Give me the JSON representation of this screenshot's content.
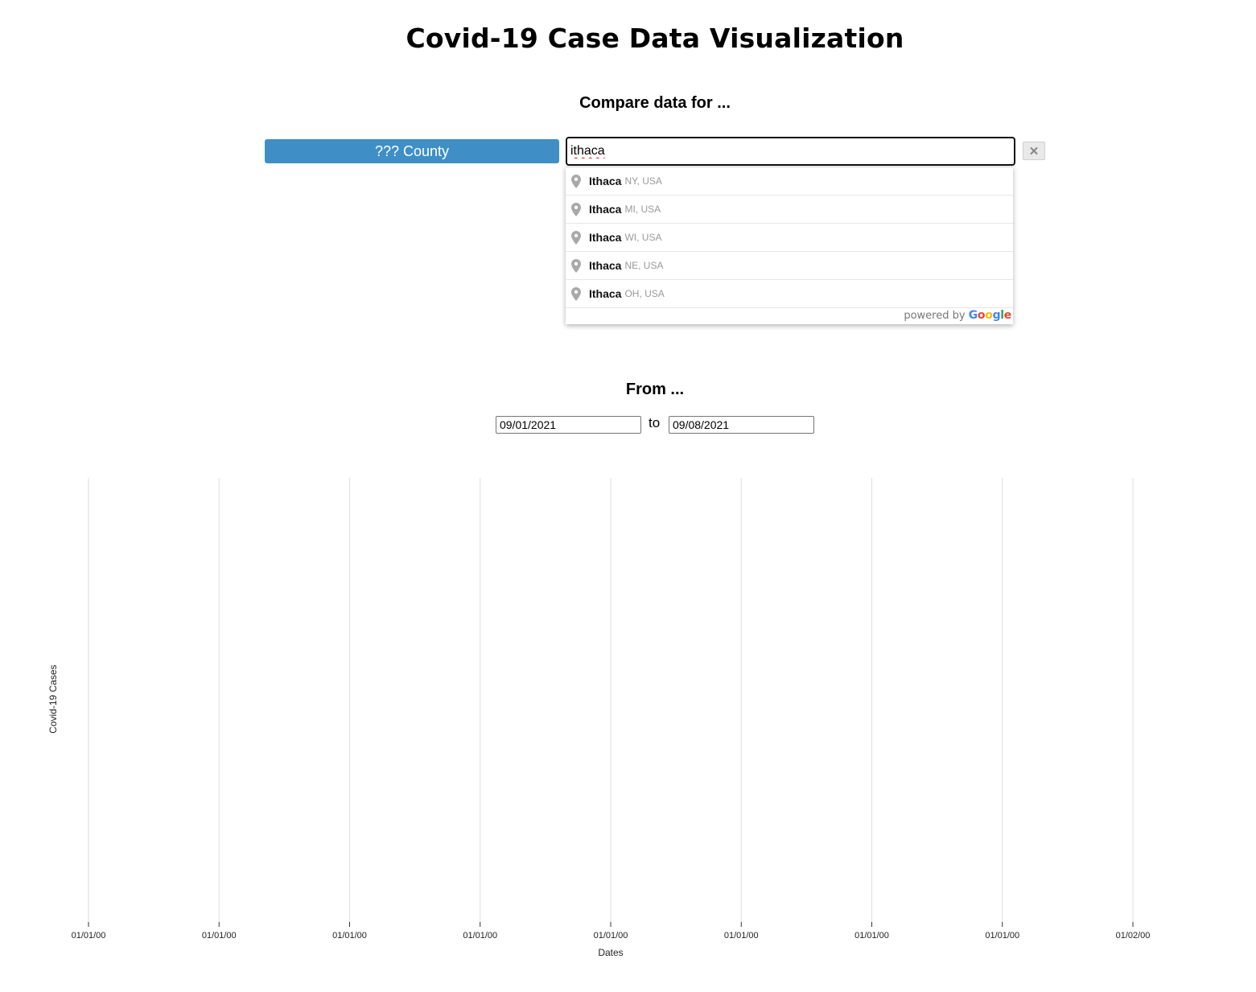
{
  "page": {
    "title": "Covid-19 Case Data Visualization",
    "compare_heading": "Compare data for ...",
    "from_heading": "From ...",
    "to_label": "to"
  },
  "location": {
    "county_label": "??? County",
    "search_value": "ithaca",
    "remove_label": "✕"
  },
  "suggestions": [
    {
      "main": "Ithaca",
      "secondary": "NY, USA"
    },
    {
      "main": "Ithaca",
      "secondary": "MI, USA"
    },
    {
      "main": "Ithaca",
      "secondary": "WI, USA"
    },
    {
      "main": "Ithaca",
      "secondary": "NE, USA"
    },
    {
      "main": "Ithaca",
      "secondary": "OH, USA"
    }
  ],
  "attribution": {
    "prefix": "powered by",
    "brand": "Google"
  },
  "date_range": {
    "start": "09/01/2021",
    "end": "09/08/2021"
  },
  "colors": {
    "chip": "#3f8fc6",
    "gridline": "#dddddd",
    "google_blue": "#4285F4",
    "google_red": "#EA4335",
    "google_yellow": "#FBBC05",
    "google_green": "#34A853"
  },
  "chart_data": {
    "type": "line",
    "xlabel": "Dates",
    "ylabel": "Covid-19 Cases",
    "x_tick_labels": [
      "01/01/00",
      "01/01/00",
      "01/01/00",
      "01/01/00",
      "01/01/00",
      "01/01/00",
      "01/01/00",
      "01/01/00",
      "01/02/00"
    ],
    "series": [],
    "grid": "vertical"
  }
}
